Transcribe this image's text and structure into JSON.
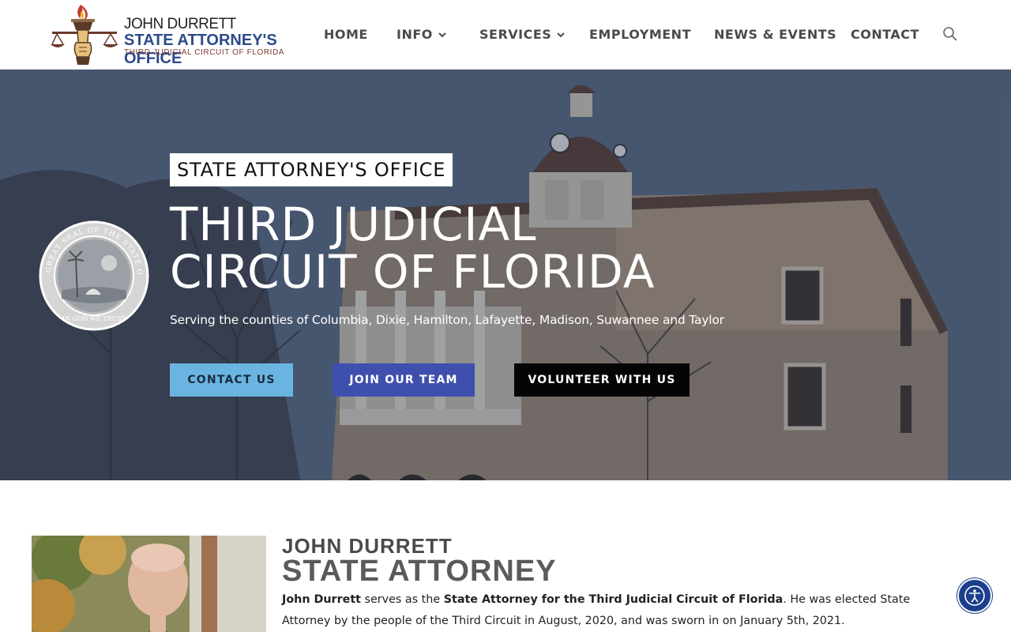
{
  "logo": {
    "line1": "JOHN DURRETT",
    "line2": "STATE ATTORNEY'S OFFICE",
    "line3": "THIRD JUDICIAL CIRCUIT OF FLORIDA"
  },
  "nav": {
    "items": [
      {
        "label": "HOME",
        "dropdown": false
      },
      {
        "label": "INFO",
        "dropdown": true
      },
      {
        "label": "SERVICES",
        "dropdown": true
      },
      {
        "label": "EMPLOYMENT",
        "dropdown": false
      },
      {
        "label": "NEWS & EVENTS",
        "dropdown": false
      },
      {
        "label": "CONTACT",
        "dropdown": false
      }
    ],
    "search_icon": "search-icon"
  },
  "hero": {
    "badge": "STATE ATTORNEY'S OFFICE",
    "title_line1": "THIRD JUDICIAL",
    "title_line2": "CIRCUIT OF FLORIDA",
    "subtitle": "Serving the counties of Columbia, Dixie, Hamilton, Lafayette, Madison, Suwannee and Taylor",
    "buttons": {
      "contact": "CONTACT US",
      "join": "JOIN OUR TEAM",
      "volunteer": "VOLUNTEER WITH US"
    },
    "seal_outer_text": "GREAT SEAL OF THE STATE OF FLORIDA",
    "seal_motto": "IN GOD WE TRUST"
  },
  "bio": {
    "name": "JOHN DURRETT",
    "title": "STATE ATTORNEY",
    "p_name": "John Durrett",
    "p_mid1": " serves as the ",
    "p_role": "State Attorney for the Third Judicial Circuit of Florida",
    "p_rest": ". He was elected State Attorney by the people of the Third Circuit in August, 2020, and was sworn in on January 5th, 2021."
  },
  "colors": {
    "nav_text": "#4a4a4a",
    "btn_contact": "#6ab4e2",
    "btn_join": "#3f4fae",
    "btn_volunteer": "#050505",
    "logo_blue": "#2d4a8a",
    "a11y_button": "#1c3f8c"
  },
  "accessibility_button": "accessibility-icon"
}
